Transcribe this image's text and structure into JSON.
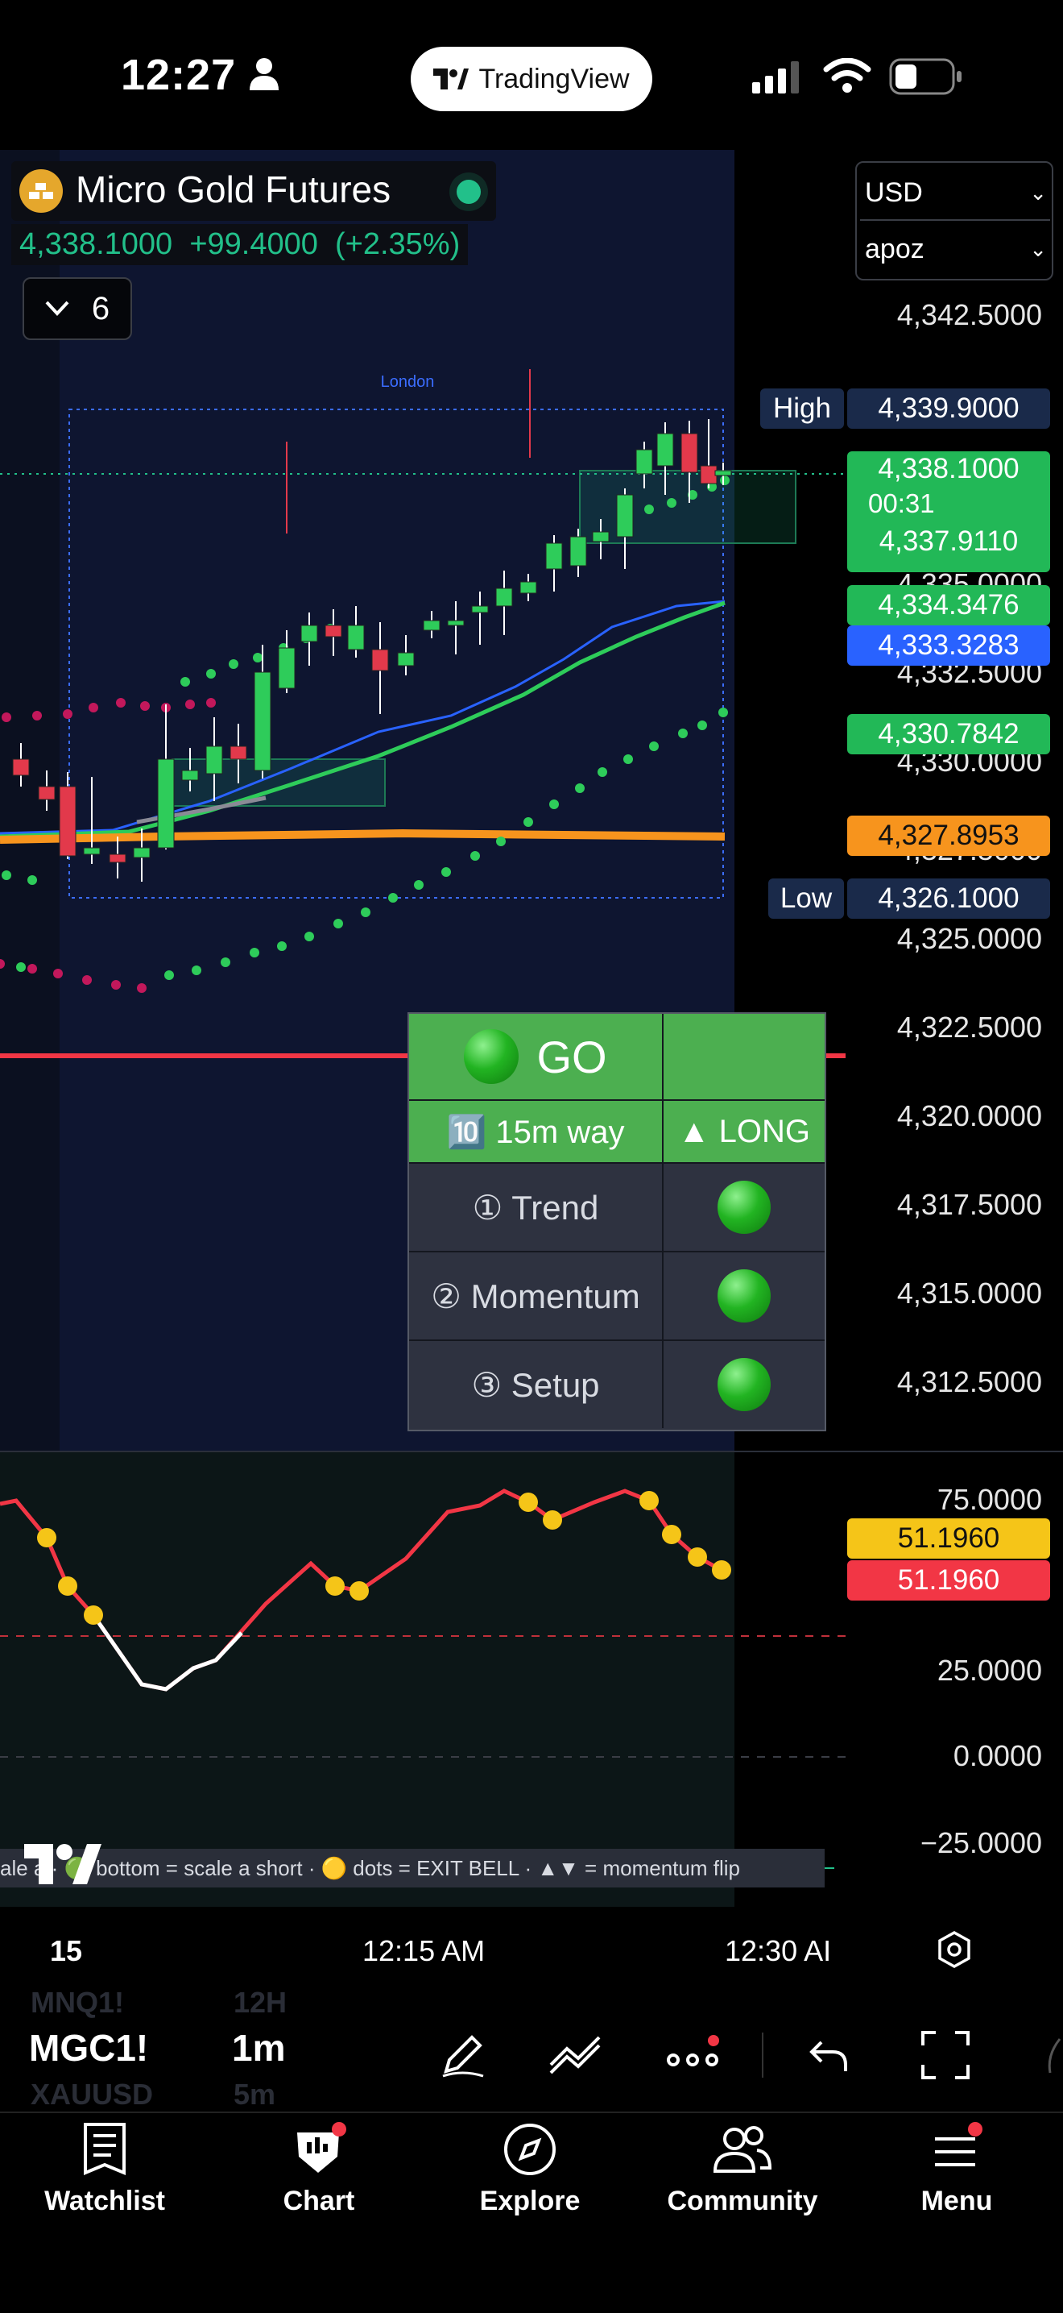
{
  "status_bar": {
    "time": "12:27",
    "app_pill": "TradingView"
  },
  "symbol": {
    "name": "Micro Gold Futures",
    "price": "4,338.1000",
    "change": "+99.4000",
    "change_pct": "(+2.35%)",
    "indicator_count": "6",
    "currency": "USD",
    "profile": "apoz"
  },
  "chart_labels": {
    "session": "London",
    "high_label": "High",
    "low_label": "Low",
    "legend_text": "ale a · 🟢 bottom = scale a short · 🟡 dots = EXIT BELL · ▲▼ = momentum flip"
  },
  "price_axis": [
    "4,342.5000",
    "4,335.0000",
    "4,332.5000",
    "4,330.0000",
    "4,327.5000",
    "4,325.0000",
    "4,322.5000",
    "4,320.0000",
    "4,317.5000",
    "4,315.0000",
    "4,312.5000"
  ],
  "price_tags": {
    "high": "4,339.9000",
    "last": "4,338.1000",
    "countdown": "00:31",
    "t1": "4,337.9110",
    "t2": "4,334.3476",
    "t3": "4,333.3283",
    "t4": "4,330.7842",
    "t5": "4,327.8953",
    "low": "4,326.1000"
  },
  "osc_axis": [
    "75.0000",
    "25.0000",
    "0.0000",
    "−25.0000"
  ],
  "osc_tags": {
    "yellow": "51.1960",
    "red": "51.1960"
  },
  "panel": {
    "go": "GO",
    "way": "🔟 15m way",
    "direction": "▲ LONG",
    "rows": [
      {
        "label": "① Trend"
      },
      {
        "label": "② Momentum"
      },
      {
        "label": "③ Setup"
      }
    ]
  },
  "time_axis": [
    "15",
    "12:15 AM",
    "12:30 AI"
  ],
  "toolbar": {
    "symbol_prev": "MNQ1!",
    "symbol": "MGC1!",
    "symbol_next": "XAUUSD",
    "interval_prev": "12H",
    "interval": "1m",
    "interval_next": "5m"
  },
  "tabs": [
    "Watchlist",
    "Chart",
    "Explore",
    "Community",
    "Menu"
  ],
  "colors": {
    "green": "#22c08a",
    "candle_up": "#2ecc5a",
    "candle_down": "#e2394b",
    "orange": "#f7941d",
    "yellow": "#f5c518",
    "red": "#f23645",
    "blue": "#2962ff"
  }
}
